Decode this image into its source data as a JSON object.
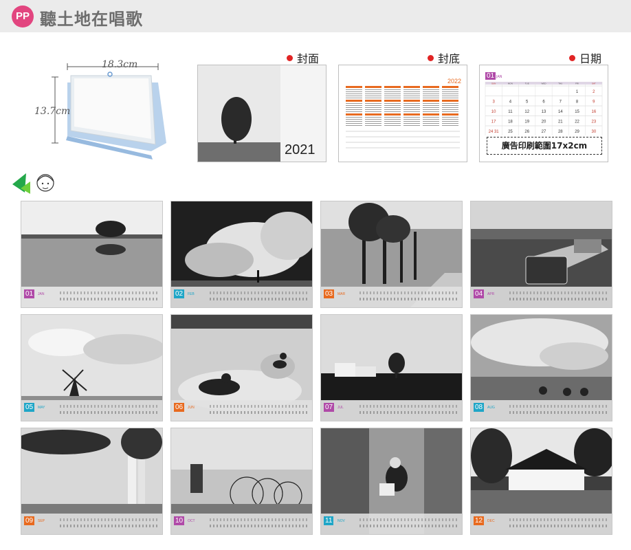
{
  "header": {
    "badge": "PP",
    "title": "聽土地在唱歌"
  },
  "desk_sample": {
    "width_label": "18.3cm",
    "height_label": "13.7cm"
  },
  "sections": {
    "cover": {
      "label": "封面",
      "year": "2021"
    },
    "back": {
      "label": "封底",
      "year": "2022"
    },
    "date": {
      "label": "日期",
      "month_num": "01",
      "month_name": "JAN",
      "weekdays": [
        "SUN",
        "MON",
        "TUE",
        "WED",
        "THU",
        "FRI",
        "SAT"
      ],
      "days": [
        [
          "",
          "",
          "",
          "",
          "",
          "1",
          "2"
        ],
        [
          "3",
          "4",
          "5",
          "6",
          "7",
          "8",
          "9"
        ],
        [
          "10",
          "11",
          "12",
          "13",
          "14",
          "15",
          "16"
        ],
        [
          "17",
          "18",
          "19",
          "20",
          "21",
          "22",
          "23"
        ],
        [
          "24",
          "31",
          "25",
          "26",
          "27",
          "28",
          "29",
          "30"
        ]
      ],
      "print_area": "廣告印刷範圍17x2cm"
    }
  },
  "months": [
    {
      "num": "01",
      "name": "JAN",
      "color": "#b04aa8"
    },
    {
      "num": "02",
      "name": "FEB",
      "color": "#1fa6c7"
    },
    {
      "num": "03",
      "name": "MAR",
      "color": "#e86a1f"
    },
    {
      "num": "04",
      "name": "APR",
      "color": "#b04aa8"
    },
    {
      "num": "05",
      "name": "MAY",
      "color": "#1fa6c7"
    },
    {
      "num": "06",
      "name": "JUN",
      "color": "#e86a1f"
    },
    {
      "num": "07",
      "name": "JUL",
      "color": "#b04aa8"
    },
    {
      "num": "08",
      "name": "AUG",
      "color": "#1fa6c7"
    },
    {
      "num": "09",
      "name": "SEP",
      "color": "#e86a1f"
    },
    {
      "num": "10",
      "name": "OCT",
      "color": "#b04aa8"
    },
    {
      "num": "11",
      "name": "NOV",
      "color": "#1fa6c7"
    },
    {
      "num": "12",
      "name": "DEC",
      "color": "#e86a1f"
    }
  ]
}
